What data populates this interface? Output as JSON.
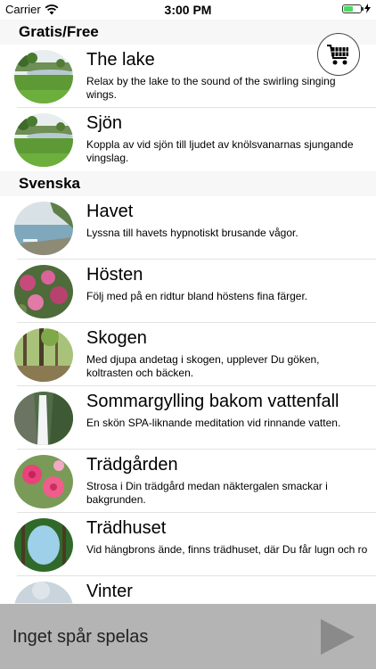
{
  "status_bar": {
    "carrier": "Carrier",
    "time": "3:00 PM"
  },
  "sections": [
    {
      "title": "Gratis/Free"
    },
    {
      "title": "Svenska"
    }
  ],
  "tracks": [
    {
      "title": "The lake",
      "description": "Relax by the lake to the sound of the swirling singing wings.",
      "image": "lake-image"
    },
    {
      "title": "Sjön",
      "description": "Koppla av vid sjön till ljudet av knölsvanarnas sjungande vingslag.",
      "image": "lake-image"
    },
    {
      "title": "Havet",
      "description": "Lyssna till havets hypnotiskt brusande vågor.",
      "image": "sea-image"
    },
    {
      "title": "Hösten",
      "description": "Följ med på en ridtur bland höstens fina färger.",
      "image": "autumn-image"
    },
    {
      "title": "Skogen",
      "description": "Med djupa andetag i skogen, upplever Du göken, koltrasten och bäcken.",
      "image": "forest-image"
    },
    {
      "title": "Sommargylling bakom vattenfall",
      "description": "En skön SPA-liknande meditation vid rinnande vatten.",
      "image": "waterfall-image"
    },
    {
      "title": "Trädgården",
      "description": "Strosa i Din trädgård medan näktergalen smackar i bakgrunden.",
      "image": "roses-image"
    },
    {
      "title": "Trädhuset",
      "description": "Vid hängbrons ände, finns trädhuset, där Du får lugn och ro",
      "image": "treehouse-image"
    },
    {
      "title": "Vinter",
      "description": "",
      "image": "winter-image"
    }
  ],
  "player": {
    "status": "Inget spår spelas"
  },
  "icons": {
    "cart": "cart-icon",
    "play": "play-icon",
    "wifi": "wifi-icon",
    "battery": "battery-icon",
    "charging": "bolt-icon"
  },
  "colors": {
    "player_bg": "#b4b4b4",
    "section_bg": "#f7f7f7",
    "battery": "#4cd964"
  }
}
